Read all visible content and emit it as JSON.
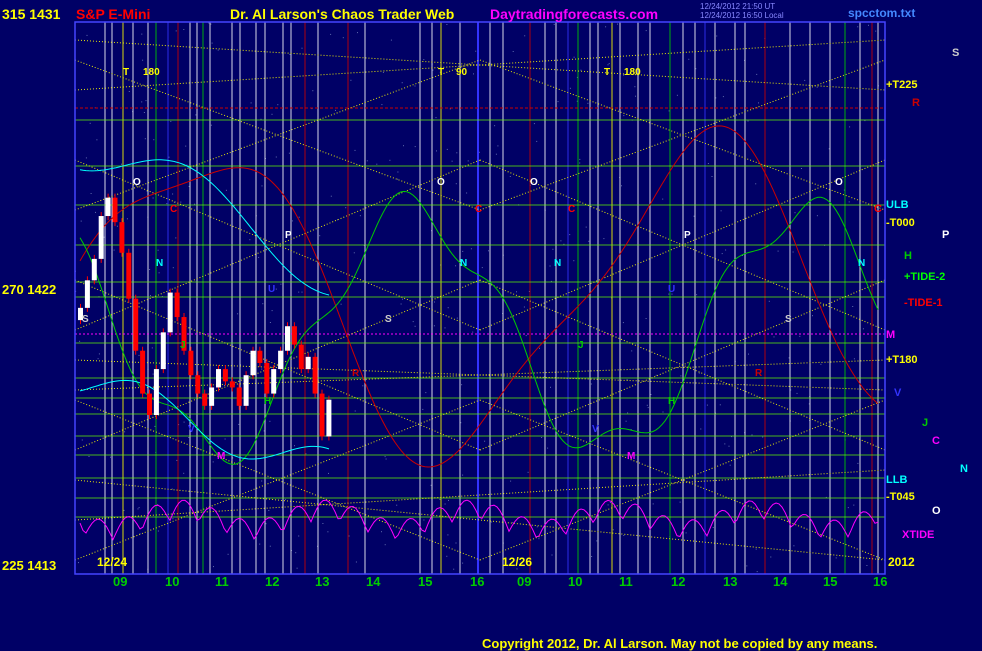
{
  "header": {
    "left_top_label": "315 1431",
    "instrument": "S&P E-Mini",
    "title": "Dr. Al Larson's Chaos Trader Web",
    "site": "Daytradingforecasts.com",
    "timestamp_1": "12/24/2012 21:50 UT",
    "timestamp_2": "12/24/2012 16:50 Local",
    "file": "spcctom.txt"
  },
  "footer": {
    "copyright": "Copyright 2012, Dr. Al Larson. May not be copied by any means."
  },
  "colors": {
    "background": "#000066",
    "frame": "#4444ff",
    "yellow": "#ffff00",
    "green": "#00cc00",
    "red": "#ff0000",
    "cyan": "#00ffff",
    "magenta": "#ff00ff",
    "white": "#ffffff",
    "blue": "#3333ff",
    "gridgreen": "#66ff00",
    "darkred": "#cc0000"
  },
  "chart_data": {
    "type": "line",
    "x_axis": {
      "day_ticks": [
        "09",
        "10",
        "11",
        "12",
        "13",
        "14",
        "15",
        "16",
        "09",
        "10",
        "11",
        "12",
        "13",
        "14",
        "15",
        "16"
      ],
      "date_markers": [
        "12/24",
        "12/26",
        "2012"
      ]
    },
    "y_axis": {
      "left_labels": [
        "315 1431",
        "270 1422",
        "225 1413"
      ]
    },
    "price_range": [
      1413,
      1431
    ],
    "series": [
      {
        "name": "S&P E-Mini bars",
        "color": "#ff0000"
      },
      {
        "name": "H",
        "color": "#00cc00"
      },
      {
        "name": "TIDE-1",
        "color": "#ff0000"
      },
      {
        "name": "N",
        "color": "#00ffff"
      },
      {
        "name": "XTIDE",
        "color": "#ff00ff"
      }
    ],
    "price_bars": [
      {
        "o": 1421.0,
        "c": 1421.4
      },
      {
        "o": 1421.4,
        "c": 1422.3
      },
      {
        "o": 1422.3,
        "c": 1423.0
      },
      {
        "o": 1423.0,
        "c": 1424.4
      },
      {
        "o": 1424.4,
        "c": 1425.0
      },
      {
        "o": 1425.0,
        "c": 1424.2
      },
      {
        "o": 1424.2,
        "c": 1423.2
      },
      {
        "o": 1423.2,
        "c": 1421.7
      },
      {
        "o": 1421.7,
        "c": 1420.0
      },
      {
        "o": 1420.0,
        "c": 1418.6
      },
      {
        "o": 1418.6,
        "c": 1417.9
      },
      {
        "o": 1417.9,
        "c": 1419.4
      },
      {
        "o": 1419.4,
        "c": 1420.6
      },
      {
        "o": 1420.6,
        "c": 1421.9
      },
      {
        "o": 1421.9,
        "c": 1421.1
      },
      {
        "o": 1421.1,
        "c": 1420.0
      },
      {
        "o": 1420.0,
        "c": 1419.2
      },
      {
        "o": 1419.2,
        "c": 1418.6
      },
      {
        "o": 1418.6,
        "c": 1418.2
      },
      {
        "o": 1418.2,
        "c": 1418.8
      },
      {
        "o": 1418.8,
        "c": 1419.4
      },
      {
        "o": 1419.4,
        "c": 1419.0
      },
      {
        "o": 1419.0,
        "c": 1418.8
      },
      {
        "o": 1418.8,
        "c": 1418.2
      },
      {
        "o": 1418.2,
        "c": 1419.2
      },
      {
        "o": 1419.2,
        "c": 1420.0
      },
      {
        "o": 1420.0,
        "c": 1419.6
      },
      {
        "o": 1419.6,
        "c": 1418.6
      },
      {
        "o": 1418.6,
        "c": 1419.4
      },
      {
        "o": 1419.4,
        "c": 1420.0
      },
      {
        "o": 1420.0,
        "c": 1420.8
      },
      {
        "o": 1420.8,
        "c": 1420.2
      },
      {
        "o": 1420.2,
        "c": 1419.4
      },
      {
        "o": 1419.4,
        "c": 1419.8
      },
      {
        "o": 1419.8,
        "c": 1418.6
      },
      {
        "o": 1418.6,
        "c": 1417.2
      },
      {
        "o": 1417.2,
        "c": 1418.4
      }
    ],
    "right_labels": [
      {
        "text": "S",
        "color": "#cccccc"
      },
      {
        "text": "+T225",
        "color": "#ffff00"
      },
      {
        "text": "R",
        "color": "#cc0000"
      },
      {
        "text": "ULB",
        "color": "#00ffff"
      },
      {
        "text": "C",
        "color": "#ff0000"
      },
      {
        "text": "-T000",
        "color": "#ffff00"
      },
      {
        "text": "P",
        "color": "#ffffff"
      },
      {
        "text": "H",
        "color": "#00cc00"
      },
      {
        "text": "+TIDE-2",
        "color": "#00ff00"
      },
      {
        "text": "-TIDE-1",
        "color": "#ff0000"
      },
      {
        "text": "M",
        "color": "#ff00ff"
      },
      {
        "text": "+T180",
        "color": "#ffff00"
      },
      {
        "text": "V",
        "color": "#3333ff"
      },
      {
        "text": "J",
        "color": "#00cc00"
      },
      {
        "text": "C",
        "color": "#ff00ff"
      },
      {
        "text": "N",
        "color": "#00ffff"
      },
      {
        "text": "LLB",
        "color": "#00ffff"
      },
      {
        "text": "-T045",
        "color": "#ffff00"
      },
      {
        "text": "O",
        "color": "#ffffff"
      },
      {
        "text": "XTIDE",
        "color": "#ff00ff"
      }
    ],
    "in_chart_labels": [
      {
        "text": "T",
        "color": "#ffff00"
      },
      {
        "text": "180",
        "color": "#ffff00"
      },
      {
        "text": "T",
        "color": "#ffff00"
      },
      {
        "text": "90",
        "color": "#ffff00"
      },
      {
        "text": "T",
        "color": "#ffff00"
      },
      {
        "text": "180",
        "color": "#ffff00"
      },
      {
        "text": "O",
        "color": "#ffffff"
      },
      {
        "text": "O",
        "color": "#ffffff"
      },
      {
        "text": "O",
        "color": "#ffffff"
      },
      {
        "text": "O",
        "color": "#ffffff"
      },
      {
        "text": "C",
        "color": "#ff0000"
      },
      {
        "text": "C",
        "color": "#ff0000"
      },
      {
        "text": "C",
        "color": "#ff0000"
      },
      {
        "text": "N",
        "color": "#00ffff"
      },
      {
        "text": "N",
        "color": "#00ffff"
      },
      {
        "text": "N",
        "color": "#00ffff"
      },
      {
        "text": "N",
        "color": "#00ffff"
      },
      {
        "text": "P",
        "color": "#ffffff"
      },
      {
        "text": "P",
        "color": "#ffffff"
      },
      {
        "text": "U",
        "color": "#3333ff"
      },
      {
        "text": "U",
        "color": "#3333ff"
      },
      {
        "text": "S",
        "color": "#cccccc"
      },
      {
        "text": "S",
        "color": "#cccccc"
      },
      {
        "text": "S",
        "color": "#cccccc"
      },
      {
        "text": "J",
        "color": "#00cc00"
      },
      {
        "text": "J",
        "color": "#00cc00"
      },
      {
        "text": "R",
        "color": "#cc0000"
      },
      {
        "text": "R",
        "color": "#cc0000"
      },
      {
        "text": "H",
        "color": "#00cc00"
      },
      {
        "text": "H",
        "color": "#00cc00"
      },
      {
        "text": "V",
        "color": "#3333ff"
      },
      {
        "text": "V",
        "color": "#3333ff"
      },
      {
        "text": "M",
        "color": "#ff00ff"
      },
      {
        "text": "M",
        "color": "#ff00ff"
      }
    ]
  }
}
